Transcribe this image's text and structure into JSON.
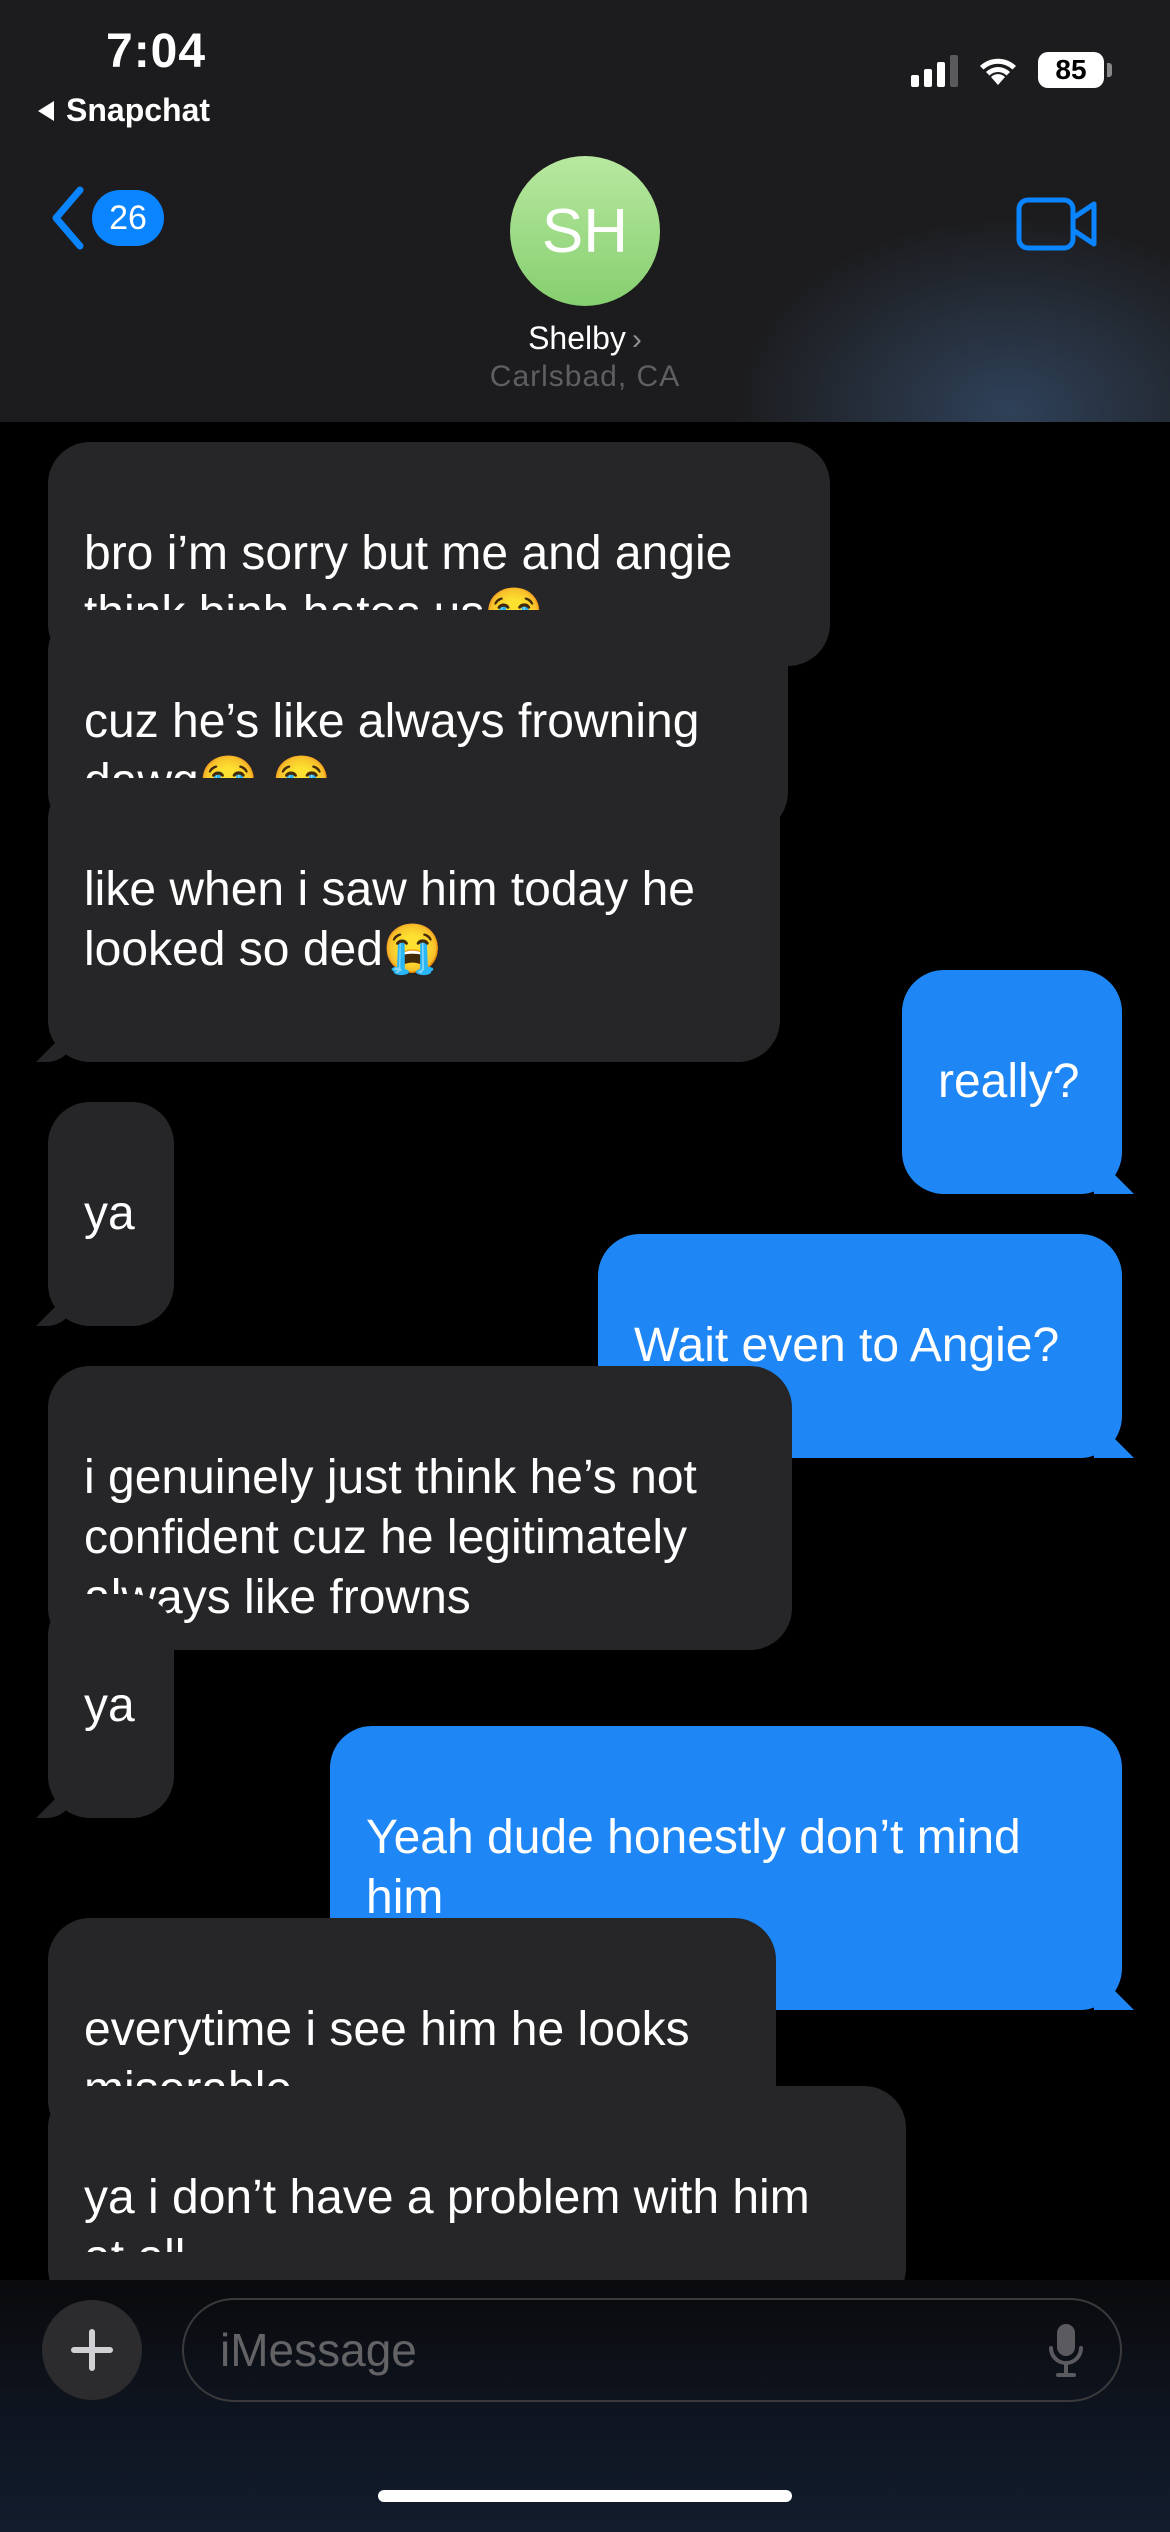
{
  "status_bar": {
    "time": "7:04",
    "back_app": "Snapchat",
    "battery": "85"
  },
  "header": {
    "unread_count": "26",
    "avatar_initials": "SH",
    "contact_name": "Shelby",
    "contact_location": "Carlsbad, CA"
  },
  "messages": [
    {
      "from": "them",
      "text": "bro i’m sorry but me and angie\nthink binh hates us😭"
    },
    {
      "from": "them",
      "text": "cuz he’s like always frowning\ndawg😭 😭"
    },
    {
      "from": "them",
      "text": "like when i saw him today he\nlooked so ded😭"
    },
    {
      "from": "me",
      "text": "really?"
    },
    {
      "from": "them",
      "text": "ya"
    },
    {
      "from": "me",
      "text": "Wait even to Angie?"
    },
    {
      "from": "them",
      "text": "i genuinely just think he’s not\nconfident cuz he legitimately\nalways like frowns"
    },
    {
      "from": "them",
      "text": "ya"
    },
    {
      "from": "me",
      "text": "Yeah dude honestly don’t mind\nhim"
    },
    {
      "from": "them",
      "text": "everytime i see him he looks\nmiserable"
    },
    {
      "from": "them",
      "text": "ya i don’t have a problem with him\nat all"
    }
  ],
  "composer": {
    "placeholder": "iMessage"
  },
  "colors": {
    "sent": "#1e87f5",
    "received": "#262628",
    "accent": "#0a84ff"
  },
  "icons": [
    "back-chevron-icon",
    "video-camera-icon",
    "plus-icon",
    "microphone-icon",
    "wifi-icon",
    "signal-icon",
    "battery-icon"
  ]
}
